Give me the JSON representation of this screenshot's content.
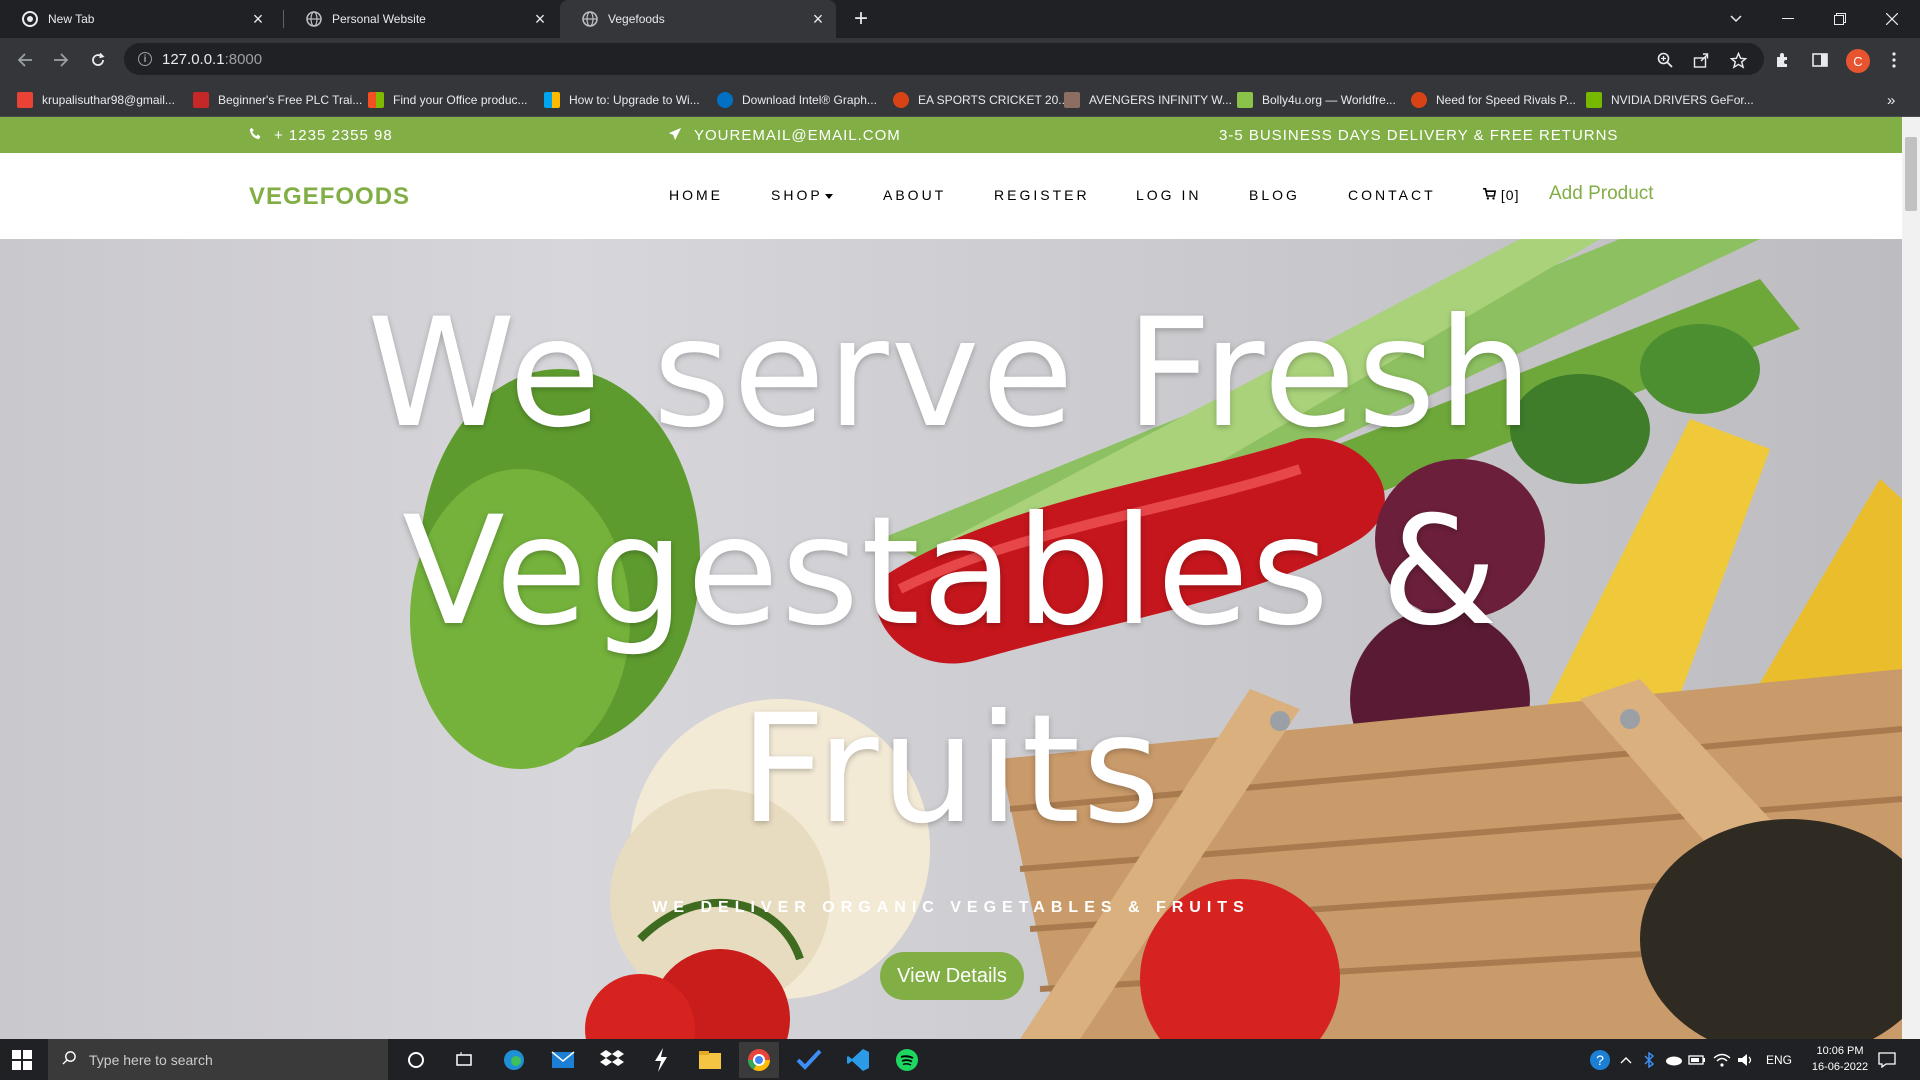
{
  "browser": {
    "tabs": [
      {
        "title": "New Tab"
      },
      {
        "title": "Personal Website"
      },
      {
        "title": "Vegefoods"
      }
    ],
    "new_tab_label": "+",
    "url_host": "127.0.0.1",
    "url_port": ":8000",
    "profile_initial": "C",
    "bookmarks": [
      {
        "label": "krupalisuthar98@gmail...",
        "color": "#ea4335"
      },
      {
        "label": "Beginner's Free PLC Trai...",
        "color": "#c62828"
      },
      {
        "label": "Find your Office produc...",
        "color": "#f25022"
      },
      {
        "label": "How to: Upgrade to Wi...",
        "color": "#00a4ef"
      },
      {
        "label": "Download Intel® Graph...",
        "color": "#0071c5"
      },
      {
        "label": "EA SPORTS CRICKET 20...",
        "color": "#d84315"
      },
      {
        "label": "AVENGERS INFINITY W...",
        "color": "#8d6e63"
      },
      {
        "label": "Bolly4u.org — Worldfre...",
        "color": "#8bc34a"
      },
      {
        "label": "Need for Speed Rivals P...",
        "color": "#d84315"
      },
      {
        "label": "NVIDIA DRIVERS GeFor...",
        "color": "#76b900"
      }
    ],
    "bookmarks_overflow": "»"
  },
  "site": {
    "topbar": {
      "phone": "+ 1235 2355 98",
      "email": "YOUREMAIL@EMAIL.COM",
      "delivery": "3-5 BUSINESS DAYS DELIVERY & FREE RETURNS"
    },
    "brand": "VEGEFOODS",
    "nav": {
      "home": "HOME",
      "shop": "SHOP",
      "about": "ABOUT",
      "register": "REGISTER",
      "login": "LOG IN",
      "blog": "BLOG",
      "contact": "CONTACT",
      "cart": "[0]",
      "add_product": "Add Product"
    },
    "hero": {
      "line1": "We serve Fresh",
      "line2": "Vegestables &",
      "line3": "Fruits",
      "subtitle": "WE DELIVER ORGANIC VEGETABLES & FRUITS",
      "button": "View Details"
    },
    "accent_color": "#82ae46"
  },
  "taskbar": {
    "search_placeholder": "Type here to search",
    "language": "ENG",
    "time": "10:06 PM",
    "date": "16-06-2022"
  }
}
